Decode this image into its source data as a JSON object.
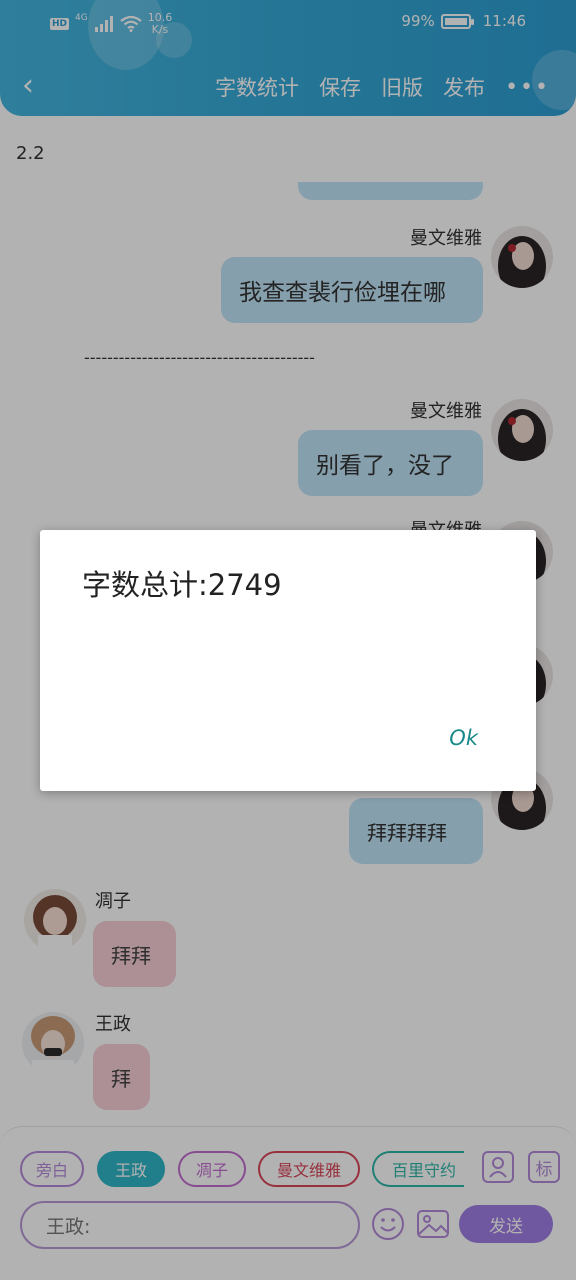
{
  "status_bar": {
    "hd": "HD",
    "network": "4G",
    "speed_top": "10.6",
    "speed_bottom": "K/s",
    "battery": "99%",
    "battery_level": 0.99,
    "time": "11:46"
  },
  "header": {
    "back_icon": "chevron-left-icon",
    "actions": [
      "字数统计",
      "保存",
      "旧版",
      "发布"
    ],
    "more_icon": "more-horizontal-icon",
    "colors": {
      "accent": "#34a7d6"
    }
  },
  "chat": {
    "date": "2.2",
    "divider": "----------------------------------------",
    "messages": [
      {
        "name": "曼文维雅",
        "text": "我查查裴行俭埋在哪",
        "side": "right"
      },
      {
        "name": "曼文维雅",
        "text": "别看了，没了",
        "side": "right"
      },
      {
        "name": "曼文维雅",
        "text": "",
        "side": "right"
      },
      {
        "name": "",
        "text": "拜拜拜拜",
        "side": "right"
      },
      {
        "name": "凋子",
        "text": "拜拜",
        "side": "left"
      },
      {
        "name": "王政",
        "text": "拜",
        "side": "left"
      }
    ]
  },
  "bottom_bar": {
    "roles": [
      {
        "label": "旁白",
        "color": "#b48ad9",
        "selected": false
      },
      {
        "label": "王政",
        "color": "#2eb6c8",
        "selected": true
      },
      {
        "label": "凋子",
        "color": "#c36fd0",
        "selected": false
      },
      {
        "label": "曼文维雅",
        "color": "#d9475a",
        "selected": false
      },
      {
        "label": "百里守约",
        "color": "#2eb6a6",
        "selected": false
      }
    ],
    "input_value": "王政:",
    "send_label": "发送",
    "icons": [
      "person-icon",
      "tag-icon",
      "emoji-icon",
      "image-icon"
    ]
  },
  "dialog": {
    "message": "字数总计:2749",
    "ok_label": "Ok"
  }
}
